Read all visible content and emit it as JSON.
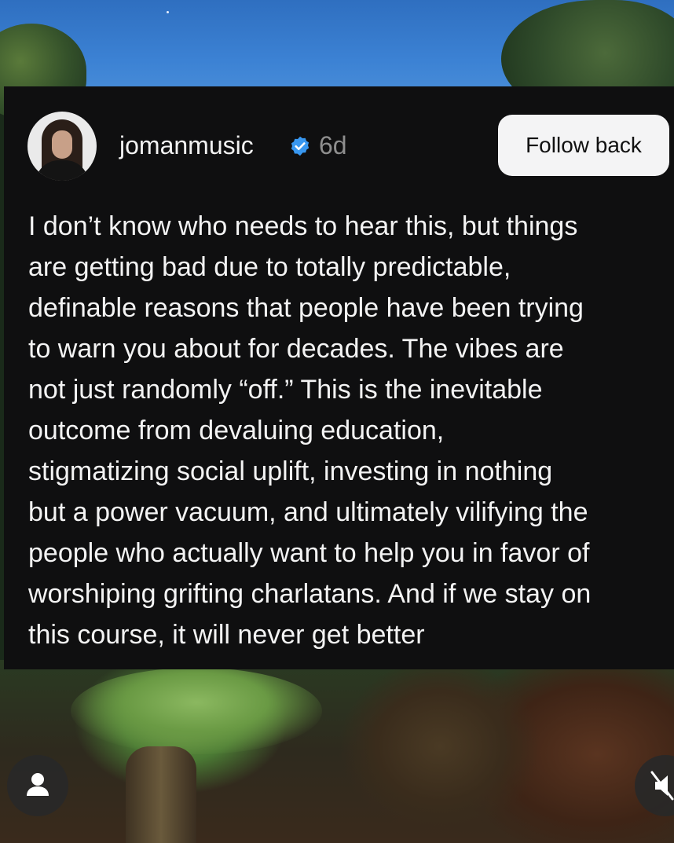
{
  "post": {
    "username": "jomanmusic",
    "time": "6d",
    "follow_label": "Follow back",
    "lines": [
      "I don’t know who needs to hear this, but things",
      "are getting bad due to totally predictable,",
      "definable reasons that people have been trying",
      "to warn you about for decades. The vibes are",
      "not just randomly “off.” This is the inevitable",
      "outcome from devaluing education,",
      "stigmatizing social uplift, investing in nothing",
      "but a power vacuum, and ultimately vilifying the",
      "people who actually want to help you in favor of",
      "worshiping grifting charlatans. And if we stay on",
      "this course, it will never get better"
    ]
  },
  "icons": {
    "verified": "verified-badge-icon",
    "profile": "person-icon",
    "mute": "speaker-muted-icon"
  },
  "colors": {
    "card_bg": "#0f0f10",
    "verified_blue": "#3897f0",
    "follow_bg": "#f4f4f5",
    "muted_text": "#8e8e8e"
  }
}
